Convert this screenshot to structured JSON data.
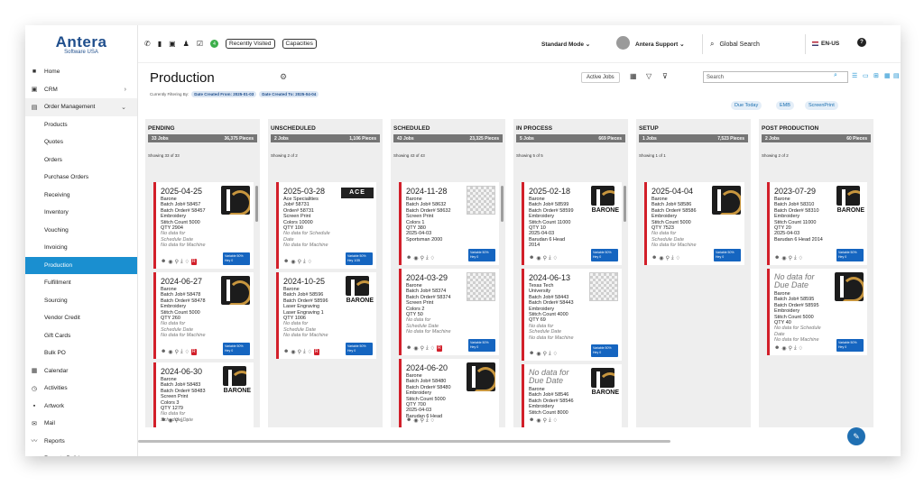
{
  "app": {
    "logo_name": "Antera",
    "logo_sub": "Software USA"
  },
  "sidebar": {
    "items": [
      {
        "label": "Home",
        "icon": "home-icon",
        "type": "top"
      },
      {
        "label": "CRM",
        "icon": "briefcase-icon",
        "type": "top",
        "chevron": "›"
      },
      {
        "label": "Order Management",
        "icon": "cart-icon",
        "type": "group",
        "chevron": "⌄"
      },
      {
        "label": "Products",
        "type": "sub"
      },
      {
        "label": "Quotes",
        "type": "sub"
      },
      {
        "label": "Orders",
        "type": "sub"
      },
      {
        "label": "Purchase Orders",
        "type": "sub"
      },
      {
        "label": "Receiving",
        "type": "sub"
      },
      {
        "label": "Inventory",
        "type": "sub"
      },
      {
        "label": "Vouching",
        "type": "sub"
      },
      {
        "label": "Invoicing",
        "type": "sub"
      },
      {
        "label": "Production",
        "type": "sub",
        "active": true
      },
      {
        "label": "Fulfillment",
        "type": "sub"
      },
      {
        "label": "Sourcing",
        "type": "sub"
      },
      {
        "label": "Vendor Credit",
        "type": "sub"
      },
      {
        "label": "Gift Cards",
        "type": "sub"
      },
      {
        "label": "Bulk PO",
        "type": "sub"
      },
      {
        "label": "Calendar",
        "icon": "calendar-icon",
        "type": "top"
      },
      {
        "label": "Activities",
        "icon": "clock-icon",
        "type": "top"
      },
      {
        "label": "Artwork",
        "icon": "artwork-icon",
        "type": "top"
      },
      {
        "label": "Mail",
        "icon": "mail-icon",
        "type": "top"
      },
      {
        "label": "Reports",
        "icon": "chart-line-icon",
        "type": "top"
      },
      {
        "label": "Reports Builder",
        "icon": "wrench-icon",
        "type": "top"
      }
    ]
  },
  "topbar": {
    "badge_count": "4",
    "recently_visited": "Recently Visited",
    "capacities": "Capacities",
    "mode": "Standard Mode",
    "user": "Antera Support",
    "search": "Global Search",
    "lang": "EN-US"
  },
  "header": {
    "title": "Production",
    "filtering_label": "Currently Filtering By:",
    "filter_from": "Date Created From: 2025-01-03",
    "filter_to": "Date Created To: 2025-04-04",
    "active_jobs": "Active Jobs",
    "search_placeholder": "Search",
    "quick_filters": [
      "Due Today",
      "EMB",
      "ScreenPrint"
    ]
  },
  "columns": [
    {
      "title": "PENDING",
      "jobs": "33 Jobs",
      "pieces": "36,375 Pieces",
      "showing": "Showing 33 of 33"
    },
    {
      "title": "UNSCHEDULED",
      "jobs": "2 Jobs",
      "pieces": "1,106 Pieces",
      "showing": "Showing 2 of 2"
    },
    {
      "title": "SCHEDULED",
      "jobs": "43 Jobs",
      "pieces": "23,325 Pieces",
      "showing": "Showing 43 of 43"
    },
    {
      "title": "IN PROCESS",
      "jobs": "5 Jobs",
      "pieces": "669 Pieces",
      "showing": "Showing 5 of 5"
    },
    {
      "title": "SETUP",
      "jobs": "1 Jobs",
      "pieces": "7,523 Pieces",
      "showing": "Showing 1 of 1"
    },
    {
      "title": "POST PRODUCTION",
      "jobs": "2 Jobs",
      "pieces": "60 Pieces",
      "showing": "Showing 2 of 2"
    }
  ],
  "cards": [
    {
      "col": 0,
      "date": "2025-04-25",
      "lines": [
        "Barone",
        "Batch Job# 58457",
        "Batch Order# 58457",
        "Embroidery",
        "Stitch Count 5000",
        "QTY 2904"
      ],
      "notes": [
        "No data for",
        "Schedule Date",
        "No data for Machine"
      ],
      "badge": "Variable 50%",
      "badge2": "Hey 0",
      "logo": "b",
      "r": true
    },
    {
      "col": 0,
      "date": "2024-06-27",
      "lines": [
        "Barone",
        "Batch Job# 58478",
        "Batch Order# 58478",
        "Embroidery",
        "Stitch Count 5000",
        "QTY 260"
      ],
      "notes": [
        "No data for",
        "Schedule Date",
        "No data for Machine"
      ],
      "badge": "Variable 50%",
      "badge2": "Hey 0",
      "logo": "b",
      "r": true
    },
    {
      "col": 0,
      "date": "2024-06-30",
      "lines": [
        "Barone",
        "Batch Job# 58483",
        "Batch Order# 58483",
        "Screen Print",
        "Colors 3",
        "QTY 1279"
      ],
      "notes": [
        "No data for",
        "Schedule Date"
      ],
      "logo": "barone"
    },
    {
      "col": 1,
      "date": "2025-03-28",
      "lines": [
        "Ace Specialities",
        "Job# 58731",
        "Order# 58731",
        "Screen Print",
        "Colors 10000",
        "QTY 100"
      ],
      "notes": [
        "No data for Schedule",
        "Date",
        "No data for Machine"
      ],
      "badge": "Variable 50%",
      "badge2": "Hey 1/35",
      "logo": "ace"
    },
    {
      "col": 1,
      "date": "2024-10-25",
      "lines": [
        "Barone",
        "Batch Job# 58596",
        "Batch Order# 58596",
        "Laser Engraving",
        "Laser Engraving 1",
        "QTY 1006"
      ],
      "notes": [
        "No data for",
        "Schedule Date",
        "No data for Machine"
      ],
      "badge": "Variable 50%",
      "badge2": "Hey 0",
      "logo": "barone",
      "r": true
    },
    {
      "col": 2,
      "date": "2024-11-28",
      "lines": [
        "Barone",
        "Batch Job# 58632",
        "Batch Order# 58632",
        "Screen Print",
        "Colors 1",
        "QTY 380",
        "2025-04-03",
        "Sportsman 2000"
      ],
      "notes": [],
      "badge": "Variable 50%",
      "badge2": "Hey 0",
      "logo": "check"
    },
    {
      "col": 2,
      "date": "2024-03-29",
      "lines": [
        "Barone",
        "Batch Job# 58374",
        "Batch Order# 58374",
        "Screen Print",
        "Colors 2",
        "QTY 50"
      ],
      "notes": [
        "No data for",
        "Schedule Date",
        "No data for Machine"
      ],
      "badge": "Variable 50%",
      "badge2": "Hey 0",
      "logo": "check",
      "r": true
    },
    {
      "col": 2,
      "date": "2024-06-20",
      "lines": [
        "Barone",
        "Batch Job# 58480",
        "Batch Order# 58480",
        "Embroidery",
        "Stitch Count 5000",
        "QTY 700",
        "2025-04-03",
        "Barudan 6 Head"
      ],
      "notes": [],
      "logo": "b"
    },
    {
      "col": 3,
      "date": "2025-02-18",
      "lines": [
        "Barone",
        "Batch Job# 58599",
        "Batch Order# 58599",
        "Embroidery",
        "Stitch Count 11000",
        "QTY 10",
        "2025-04-03",
        "Barudan 6 Head",
        "2014"
      ],
      "notes": [],
      "badge": "Variable 50%",
      "badge2": "Hey 0",
      "logo": "barone"
    },
    {
      "col": 3,
      "date": "2024-06-13",
      "lines": [
        "Texas Tech",
        "University",
        "Batch Job# 58443",
        "Batch Order# 58443",
        "Embroidery",
        "Stitch Count 4000",
        "QTY 69"
      ],
      "notes": [
        "No data for",
        "Schedule Date",
        "No data for Machine"
      ],
      "badge": "Variable 50%",
      "badge2": "Hey 0",
      "logo": "check"
    },
    {
      "col": 3,
      "date": "No data for Due Date",
      "italic_date": true,
      "lines": [
        "Barone",
        "Batch Job# 58546",
        "Batch Order# 58546",
        "Embroidery",
        "Stitch Count 8000"
      ],
      "notes": [],
      "logo": "barone"
    },
    {
      "col": 4,
      "date": "2025-04-04",
      "lines": [
        "Barone",
        "Batch Job# 58586",
        "Batch Order# 58586",
        "Embroidery",
        "Stitch Count 5000",
        "QTY 7523"
      ],
      "notes": [
        "No data for",
        "Schedule Date",
        "No data for Machine"
      ],
      "badge": "Variable 50%",
      "badge2": "Hey 0",
      "logo": "b"
    },
    {
      "col": 5,
      "date": "2023-07-29",
      "lines": [
        "Barone",
        "Batch Job# 58310",
        "Batch Order# 58310",
        "Embroidery",
        "Stitch Count 11000",
        "QTY 20",
        "2025-04-03",
        "Barudan 6 Head 2014"
      ],
      "notes": [],
      "badge": "Variable 50%",
      "badge2": "Hey 0",
      "logo": "barone"
    },
    {
      "col": 5,
      "date": "No data for Due Date",
      "italic_date": true,
      "lines": [
        "Barone",
        "Batch Job# 58595",
        "Batch Order# 58595",
        "Embroidery",
        "Stitch Count 5000",
        "QTY 40"
      ],
      "notes": [
        "No data for Schedule",
        "Date",
        "No data for Machine"
      ],
      "badge": "Variable 50%",
      "badge2": "Hey 0",
      "logo": "b"
    }
  ]
}
